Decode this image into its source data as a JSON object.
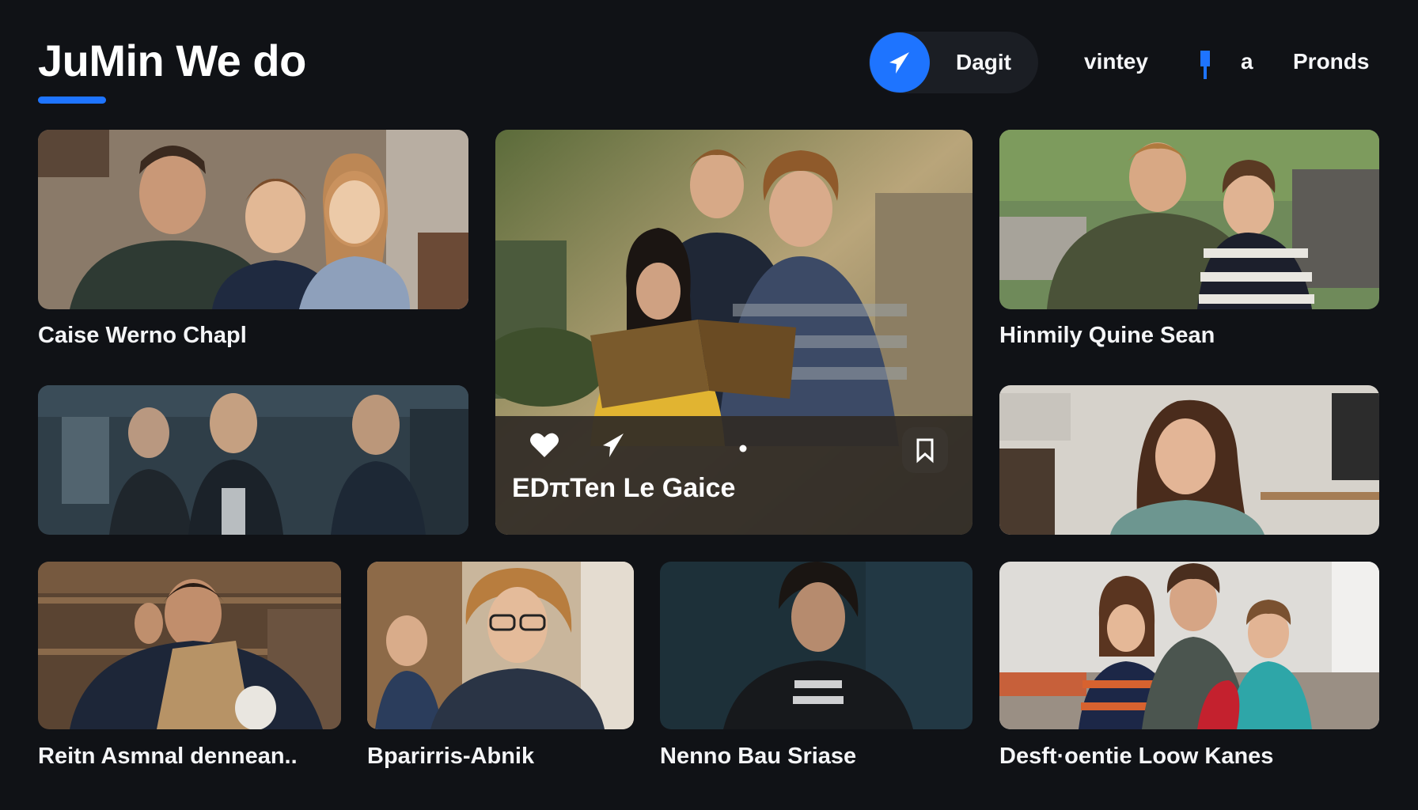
{
  "header": {
    "title": "JuMin We do"
  },
  "nav": {
    "pill_label": "Dagit",
    "links": [
      "vintey",
      "a",
      "Pronds"
    ],
    "accent": "#1e74ff"
  },
  "featured": {
    "title": "EDπTen Le Gaice",
    "actions": [
      "heart-icon",
      "share-icon",
      "dot-indicator",
      "bookmark-icon"
    ]
  },
  "cards": [
    {
      "title": "Caise Werno Chapl"
    },
    {
      "title": "Hinmily Quine Sean"
    },
    {
      "title": ""
    },
    {
      "title": ""
    },
    {
      "title": "Reitn Asmnal dennean.."
    },
    {
      "title": "Bparirris-Abnik"
    },
    {
      "title": "Nenno Bau Sriase"
    },
    {
      "title": "Desft·oentie Loow Kanes"
    }
  ]
}
